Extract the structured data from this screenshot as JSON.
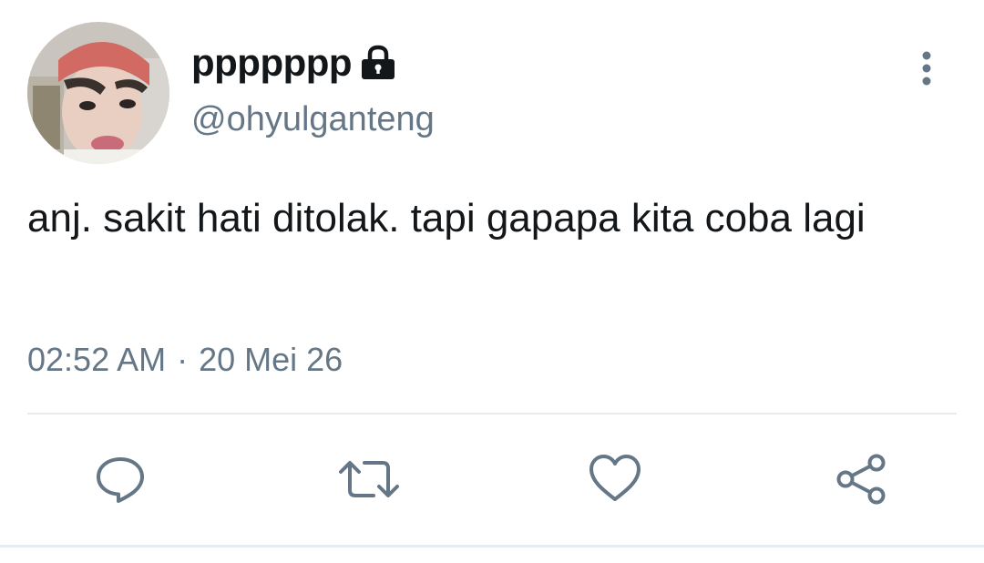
{
  "tweet": {
    "display_name": "ppppppp",
    "handle": "@ohyulganteng",
    "text": "anj. sakit hati ditolak. tapi gapapa kita coba lagi",
    "time": "02:52 AM",
    "separator": "·",
    "date": "20 Mei 26",
    "protected": true
  },
  "icons": {
    "lock": "lock-icon",
    "more": "more-vertical-icon",
    "reply": "reply-bubble-icon",
    "retweet": "retweet-icon",
    "like": "heart-icon",
    "share": "share-icon"
  },
  "colors": {
    "text_primary": "#14171a",
    "text_secondary": "#657786",
    "icon": "#657786",
    "divider": "#e6ecf0",
    "background": "#ffffff"
  }
}
